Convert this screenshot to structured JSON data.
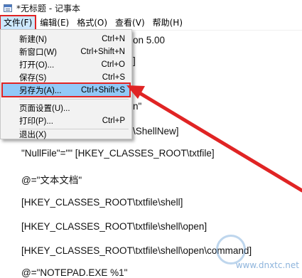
{
  "window": {
    "title": "*无标题 - 记事本"
  },
  "menubar": {
    "items": [
      {
        "label": "文件(F)"
      },
      {
        "label": "编辑(E)"
      },
      {
        "label": "格式(O)"
      },
      {
        "label": "查看(V)"
      },
      {
        "label": "帮助(H)"
      }
    ]
  },
  "editor": {
    "lines": [
      "on 5.00",
      "]",
      "",
      "n\"",
      "\\ShellNew]",
      "\"NullFile\"=\"\" [HKEY_CLASSES_ROOT\\txtfile]",
      "@=\"文本文档\"",
      "[HKEY_CLASSES_ROOT\\txtfile\\shell]",
      "[HKEY_CLASSES_ROOT\\txtfile\\shell\\open]",
      "[HKEY_CLASSES_ROOT\\txtfile\\shell\\open\\command]",
      "@=\"NOTEPAD.EXE %1\""
    ]
  },
  "file_menu": {
    "items": [
      {
        "label": "新建(N)",
        "shortcut": "Ctrl+N"
      },
      {
        "label": "新窗口(W)",
        "shortcut": "Ctrl+Shift+N"
      },
      {
        "label": "打开(O)...",
        "shortcut": "Ctrl+O"
      },
      {
        "label": "保存(S)",
        "shortcut": "Ctrl+S"
      },
      {
        "label": "另存为(A)...",
        "shortcut": "Ctrl+Shift+S"
      },
      {
        "label": "页面设置(U)...",
        "shortcut": ""
      },
      {
        "label": "打印(P)...",
        "shortcut": "Ctrl+P"
      },
      {
        "label": "退出(X)",
        "shortcut": ""
      }
    ]
  },
  "watermark": {
    "site": "www.dnxtc.net"
  },
  "colors": {
    "highlight_border": "#e02424",
    "menu_highlight": "#91c9f7",
    "arrow": "#e02424"
  }
}
